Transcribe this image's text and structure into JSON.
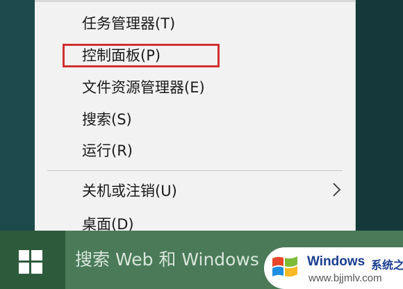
{
  "context_menu": {
    "items": [
      {
        "label": "任务管理器(T)"
      },
      {
        "label": "控制面板(P)"
      },
      {
        "label": "文件资源管理器(E)"
      },
      {
        "label": "搜索(S)"
      },
      {
        "label": "运行(R)"
      },
      {
        "label": "关机或注销(U)",
        "has_submenu": true,
        "submenu_icon": "chevron-right-icon"
      },
      {
        "label": "桌面(D)"
      }
    ],
    "highlight_color": "#d03030"
  },
  "taskbar": {
    "start_icon": "windows-logo-icon",
    "search_placeholder": "搜索 Web 和 Windows"
  },
  "watermark": {
    "title": "Windows",
    "subtitle": "系统之家",
    "url": "www.bjjmlv.com"
  }
}
